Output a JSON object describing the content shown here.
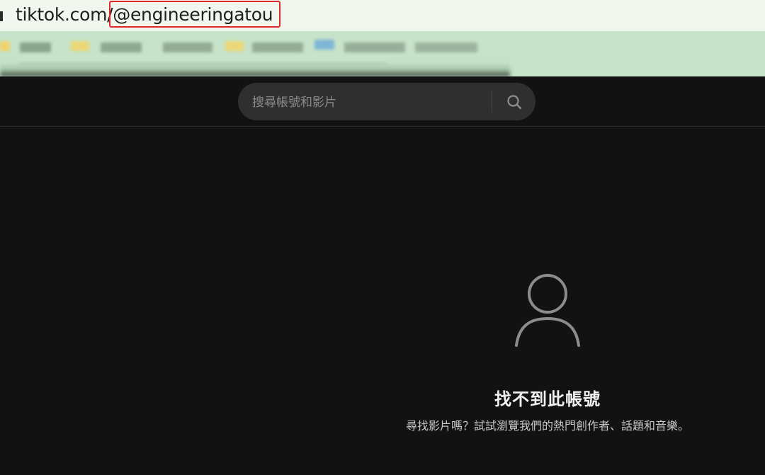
{
  "browser": {
    "url_prefix": "tiktok.com/",
    "url_handle": "@engineeringatou"
  },
  "search": {
    "placeholder": "搜尋帳號和影片",
    "icon": "search-icon"
  },
  "empty_state": {
    "icon": "user-icon",
    "title": "找不到此帳號",
    "description": "尋找影片嗎？試試瀏覽我們的熱門創作者、話題和音樂。"
  },
  "colors": {
    "background": "#121212",
    "address_bar": "#f1f6ef",
    "bookmarks_bar": "#c7e3c9",
    "search_box": "#2f2f2f",
    "highlight_border": "#e0282c"
  }
}
